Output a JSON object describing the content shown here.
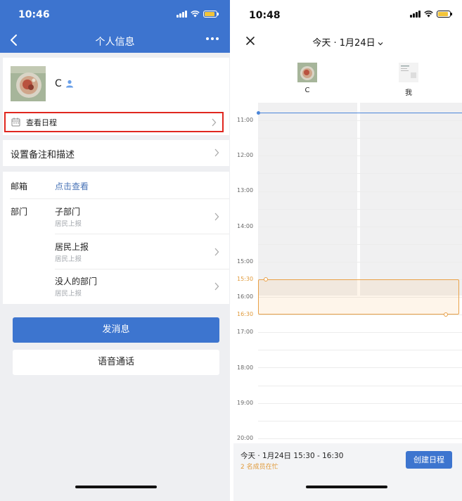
{
  "left": {
    "status_time": "10:46",
    "nav_title": "个人信息",
    "profile": {
      "name": "C"
    },
    "schedule_link": "查看日程",
    "remark_row": "设置备注和描述",
    "email": {
      "label": "邮箱",
      "action": "点击查看"
    },
    "department": {
      "label": "部门",
      "items": [
        {
          "name": "子部门",
          "parent": "居民上报"
        },
        {
          "name": "居民上报",
          "parent": "居民上报"
        },
        {
          "name": "没人的部门",
          "parent": "居民上报"
        }
      ]
    },
    "send_message": "发消息",
    "voice_call": "语音通话"
  },
  "right": {
    "status_time": "10:48",
    "title": "今天 · 1月24日",
    "people": [
      {
        "label": "C"
      },
      {
        "label": "我"
      }
    ],
    "hours": [
      "11:00",
      "12:00",
      "13:00",
      "14:00",
      "15:00",
      "15:30",
      "16:00",
      "16:30",
      "17:00",
      "18:00",
      "19:00",
      "20:00"
    ],
    "selection": {
      "start": "15:30",
      "end": "16:30"
    },
    "summary": "今天 · 1月24日 15:30 - 16:30",
    "busy_note": "2 名成员在忙",
    "create_button": "创建日程"
  },
  "colors": {
    "brand_blue": "#3d74cf",
    "highlight_red": "#e0271f",
    "selection_orange": "#e9a148",
    "now_line_blue": "#4a85d8"
  },
  "icons": [
    "back-icon",
    "more-icon",
    "person-icon",
    "calendar-icon",
    "chevron-right-icon",
    "close-icon",
    "caret-down-icon",
    "signal-icon",
    "wifi-icon",
    "battery-icon"
  ]
}
